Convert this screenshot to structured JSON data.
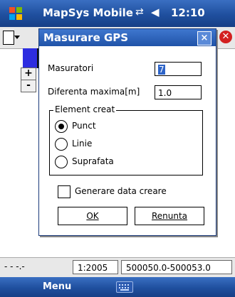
{
  "topbar": {
    "title": "MapSys Mobile",
    "time": "12:10",
    "connection_icon": "connectivity-icon",
    "volume_icon": "speaker-icon"
  },
  "app": {
    "zoom_in_label": "+",
    "zoom_out_label": "-"
  },
  "dialog": {
    "title": "Masurare GPS",
    "close_label": "×",
    "fields": {
      "masuratori_label": "Masuratori",
      "masuratori_value": "7",
      "diferenta_label": "Diferenta maxima[m]",
      "diferenta_value": "1.0"
    },
    "group": {
      "label": "Element creat",
      "options": [
        {
          "label": "Punct",
          "selected": true
        },
        {
          "label": "Linie",
          "selected": false
        },
        {
          "label": "Suprafata",
          "selected": false
        }
      ]
    },
    "checkbox": {
      "label": "Generare data creare",
      "checked": false
    },
    "ok_label": "OK",
    "cancel_label": "Renunta"
  },
  "statusbar": {
    "left_text": "- - -.-",
    "scale": "1:2005",
    "coords": "500050.0-500053.0"
  },
  "bottombar": {
    "menu_label": "Menu"
  },
  "colors": {
    "titlebar": "#1f4f9e",
    "selection": "#2d64c8",
    "close_red": "#d32020"
  }
}
